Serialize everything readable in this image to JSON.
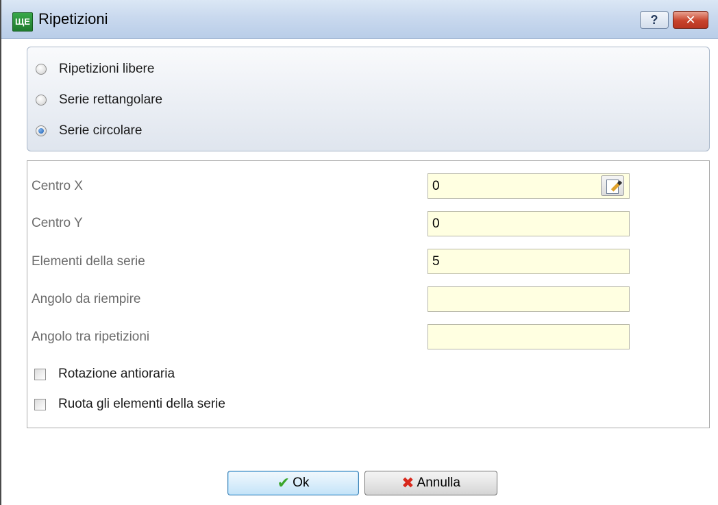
{
  "window": {
    "title": "Ripetizioni",
    "app_icon_text": "ЩЕ",
    "help_label": "?",
    "close_label": "✕"
  },
  "mode": {
    "options": [
      {
        "label": "Ripetizioni libere",
        "checked": false
      },
      {
        "label": "Serie rettangolare",
        "checked": false
      },
      {
        "label": "Serie circolare",
        "checked": true
      }
    ]
  },
  "params": {
    "fields": [
      {
        "label": "Centro X",
        "value": "0"
      },
      {
        "label": "Centro Y",
        "value": "0"
      },
      {
        "label": "Elementi della serie",
        "value": "5"
      },
      {
        "label": "Angolo da riempire",
        "value": ""
      },
      {
        "label": "Angolo tra ripetizioni",
        "value": ""
      }
    ],
    "edit_icon": "edit-note-icon",
    "checkboxes": [
      {
        "label": "Rotazione antioraria",
        "checked": false
      },
      {
        "label": "Ruota gli elementi della serie",
        "checked": false
      }
    ]
  },
  "buttons": {
    "ok_label": "Ok",
    "ok_icon": "checkmark-icon",
    "cancel_label": "Annulla",
    "cancel_icon": "red-x-icon"
  },
  "colors": {
    "field_background": "#ffffe1",
    "ok_icon": "#3aa52a",
    "cancel_icon": "#d8281c"
  }
}
